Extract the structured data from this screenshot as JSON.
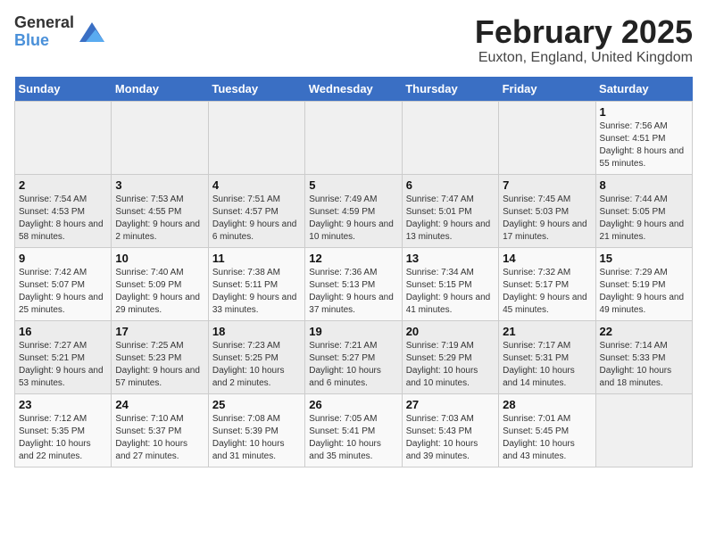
{
  "header": {
    "logo_general": "General",
    "logo_blue": "Blue",
    "title": "February 2025",
    "subtitle": "Euxton, England, United Kingdom"
  },
  "days_of_week": [
    "Sunday",
    "Monday",
    "Tuesday",
    "Wednesday",
    "Thursday",
    "Friday",
    "Saturday"
  ],
  "weeks": [
    [
      {
        "day": "",
        "info": ""
      },
      {
        "day": "",
        "info": ""
      },
      {
        "day": "",
        "info": ""
      },
      {
        "day": "",
        "info": ""
      },
      {
        "day": "",
        "info": ""
      },
      {
        "day": "",
        "info": ""
      },
      {
        "day": "1",
        "info": "Sunrise: 7:56 AM\nSunset: 4:51 PM\nDaylight: 8 hours and 55 minutes."
      }
    ],
    [
      {
        "day": "2",
        "info": "Sunrise: 7:54 AM\nSunset: 4:53 PM\nDaylight: 8 hours and 58 minutes."
      },
      {
        "day": "3",
        "info": "Sunrise: 7:53 AM\nSunset: 4:55 PM\nDaylight: 9 hours and 2 minutes."
      },
      {
        "day": "4",
        "info": "Sunrise: 7:51 AM\nSunset: 4:57 PM\nDaylight: 9 hours and 6 minutes."
      },
      {
        "day": "5",
        "info": "Sunrise: 7:49 AM\nSunset: 4:59 PM\nDaylight: 9 hours and 10 minutes."
      },
      {
        "day": "6",
        "info": "Sunrise: 7:47 AM\nSunset: 5:01 PM\nDaylight: 9 hours and 13 minutes."
      },
      {
        "day": "7",
        "info": "Sunrise: 7:45 AM\nSunset: 5:03 PM\nDaylight: 9 hours and 17 minutes."
      },
      {
        "day": "8",
        "info": "Sunrise: 7:44 AM\nSunset: 5:05 PM\nDaylight: 9 hours and 21 minutes."
      }
    ],
    [
      {
        "day": "9",
        "info": "Sunrise: 7:42 AM\nSunset: 5:07 PM\nDaylight: 9 hours and 25 minutes."
      },
      {
        "day": "10",
        "info": "Sunrise: 7:40 AM\nSunset: 5:09 PM\nDaylight: 9 hours and 29 minutes."
      },
      {
        "day": "11",
        "info": "Sunrise: 7:38 AM\nSunset: 5:11 PM\nDaylight: 9 hours and 33 minutes."
      },
      {
        "day": "12",
        "info": "Sunrise: 7:36 AM\nSunset: 5:13 PM\nDaylight: 9 hours and 37 minutes."
      },
      {
        "day": "13",
        "info": "Sunrise: 7:34 AM\nSunset: 5:15 PM\nDaylight: 9 hours and 41 minutes."
      },
      {
        "day": "14",
        "info": "Sunrise: 7:32 AM\nSunset: 5:17 PM\nDaylight: 9 hours and 45 minutes."
      },
      {
        "day": "15",
        "info": "Sunrise: 7:29 AM\nSunset: 5:19 PM\nDaylight: 9 hours and 49 minutes."
      }
    ],
    [
      {
        "day": "16",
        "info": "Sunrise: 7:27 AM\nSunset: 5:21 PM\nDaylight: 9 hours and 53 minutes."
      },
      {
        "day": "17",
        "info": "Sunrise: 7:25 AM\nSunset: 5:23 PM\nDaylight: 9 hours and 57 minutes."
      },
      {
        "day": "18",
        "info": "Sunrise: 7:23 AM\nSunset: 5:25 PM\nDaylight: 10 hours and 2 minutes."
      },
      {
        "day": "19",
        "info": "Sunrise: 7:21 AM\nSunset: 5:27 PM\nDaylight: 10 hours and 6 minutes."
      },
      {
        "day": "20",
        "info": "Sunrise: 7:19 AM\nSunset: 5:29 PM\nDaylight: 10 hours and 10 minutes."
      },
      {
        "day": "21",
        "info": "Sunrise: 7:17 AM\nSunset: 5:31 PM\nDaylight: 10 hours and 14 minutes."
      },
      {
        "day": "22",
        "info": "Sunrise: 7:14 AM\nSunset: 5:33 PM\nDaylight: 10 hours and 18 minutes."
      }
    ],
    [
      {
        "day": "23",
        "info": "Sunrise: 7:12 AM\nSunset: 5:35 PM\nDaylight: 10 hours and 22 minutes."
      },
      {
        "day": "24",
        "info": "Sunrise: 7:10 AM\nSunset: 5:37 PM\nDaylight: 10 hours and 27 minutes."
      },
      {
        "day": "25",
        "info": "Sunrise: 7:08 AM\nSunset: 5:39 PM\nDaylight: 10 hours and 31 minutes."
      },
      {
        "day": "26",
        "info": "Sunrise: 7:05 AM\nSunset: 5:41 PM\nDaylight: 10 hours and 35 minutes."
      },
      {
        "day": "27",
        "info": "Sunrise: 7:03 AM\nSunset: 5:43 PM\nDaylight: 10 hours and 39 minutes."
      },
      {
        "day": "28",
        "info": "Sunrise: 7:01 AM\nSunset: 5:45 PM\nDaylight: 10 hours and 43 minutes."
      },
      {
        "day": "",
        "info": ""
      }
    ]
  ]
}
